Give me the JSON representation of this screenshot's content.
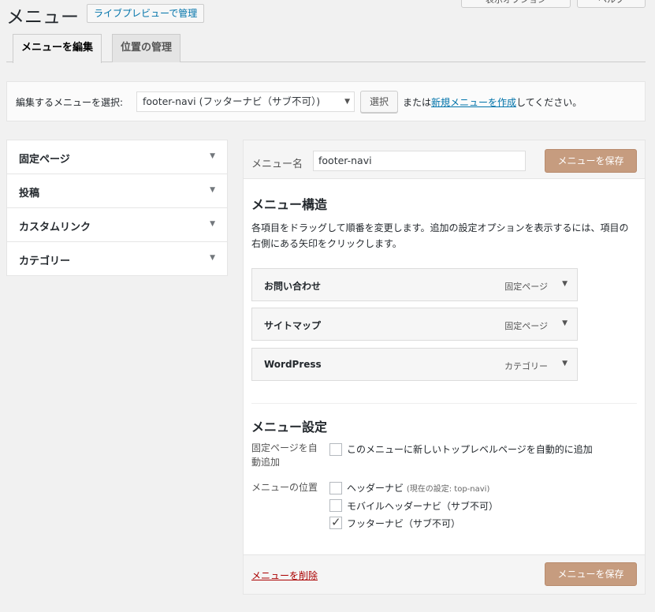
{
  "top_buttons": {
    "screen_options": "表示オプション",
    "help": "ヘルプ"
  },
  "page_title": "メニュー",
  "live_preview_button": "ライブプレビューで管理",
  "tabs": [
    {
      "label": "メニューを編集",
      "active": true
    },
    {
      "label": "位置の管理",
      "active": false
    }
  ],
  "select_bar": {
    "label": "編集するメニューを選択:",
    "selected_menu": "footer-navi (フッターナビ（サブ不可）)",
    "select_button": "選択",
    "or_text": "または",
    "create_link": "新規メニューを作成",
    "suffix": "してください。"
  },
  "sidebar": {
    "items": [
      {
        "label": "固定ページ"
      },
      {
        "label": "投稿"
      },
      {
        "label": "カスタムリンク"
      },
      {
        "label": "カテゴリー"
      }
    ]
  },
  "editor": {
    "name_label": "メニュー名",
    "name_value": "footer-navi",
    "save_button": "メニューを保存",
    "structure_title": "メニュー構造",
    "structure_desc": "各項目をドラッグして順番を変更します。追加の設定オプションを表示するには、項目の右側にある矢印をクリックします。",
    "items": [
      {
        "title": "お問い合わせ",
        "type": "固定ページ"
      },
      {
        "title": "サイトマップ",
        "type": "固定ページ"
      },
      {
        "title": "WordPress",
        "type": "カテゴリー"
      }
    ],
    "settings_title": "メニュー設定",
    "auto_add_label": "固定ページを自動追加",
    "auto_add_option": "このメニューに新しいトップレベルページを自動的に追加",
    "location_label": "メニューの位置",
    "locations": [
      {
        "label": "ヘッダーナビ",
        "note": "(現在の設定: top-navi)",
        "checked": false
      },
      {
        "label": "モバイルヘッダーナビ（サブ不可）",
        "note": "",
        "checked": false
      },
      {
        "label": "フッターナビ（サブ不可）",
        "note": "",
        "checked": true
      }
    ],
    "delete_link": "メニューを削除"
  },
  "colors": {
    "save_button": "#c69c7f",
    "link": "#0073aa",
    "delete": "#aa0000"
  }
}
